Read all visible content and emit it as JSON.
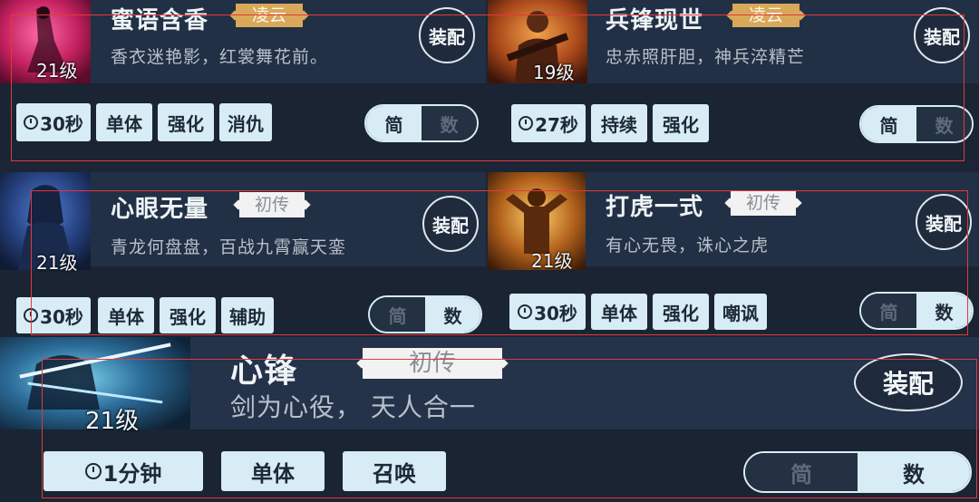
{
  "cards": [
    {
      "name": "蜜语含香",
      "rank": "凌云",
      "rank_style": "gold",
      "desc": "香衣迷艳影，红裳舞花前。",
      "level": "21级",
      "equip": "装配",
      "cooldown": "30秒",
      "tags": [
        "单体",
        "强化",
        "消仇"
      ],
      "toggle": {
        "simple": "简",
        "number": "数",
        "active": "simple"
      },
      "portrait_icon": "dancer-portrait-icon"
    },
    {
      "name": "兵锋现世",
      "rank": "凌云",
      "rank_style": "gold",
      "desc": "忠赤照肝胆，神兵淬精芒",
      "level": "19级",
      "equip": "装配",
      "cooldown": "27秒",
      "tags": [
        "持续",
        "强化"
      ],
      "toggle": {
        "simple": "简",
        "number": "数",
        "active": "simple"
      },
      "portrait_icon": "warrior-portrait-icon"
    },
    {
      "name": "心眼无量",
      "rank": "初传",
      "rank_style": "white",
      "desc": "青龙何盘盘，百战九霄赢天銮",
      "level": "21级",
      "equip": "装配",
      "cooldown": "30秒",
      "tags": [
        "单体",
        "强化",
        "辅助"
      ],
      "toggle": {
        "simple": "简",
        "number": "数",
        "active": "number"
      },
      "portrait_icon": "swordsman-portrait-icon"
    },
    {
      "name": "打虎一式",
      "rank": "初传",
      "rank_style": "white",
      "desc": "有心无畏，诛心之虎",
      "level": "21级",
      "equip": "装配",
      "cooldown": "30秒",
      "tags": [
        "单体",
        "强化",
        "嘲讽"
      ],
      "toggle": {
        "simple": "简",
        "number": "数",
        "active": "number"
      },
      "portrait_icon": "fighter-portrait-icon"
    },
    {
      "name": "心锋",
      "rank": "初传",
      "rank_style": "white",
      "desc": "剑为心役， 天人合一",
      "level": "21级",
      "equip": "装配",
      "cooldown": "1分钟",
      "tags": [
        "单体",
        "召唤"
      ],
      "toggle": {
        "simple": "简",
        "number": "数",
        "active": "number"
      },
      "portrait_icon": "blade-spirit-portrait-icon"
    }
  ],
  "colors": {
    "rank_gold": "#d9a85a",
    "tag_bg": "#d7ecf4",
    "annotation_box": "#e23a3a"
  }
}
